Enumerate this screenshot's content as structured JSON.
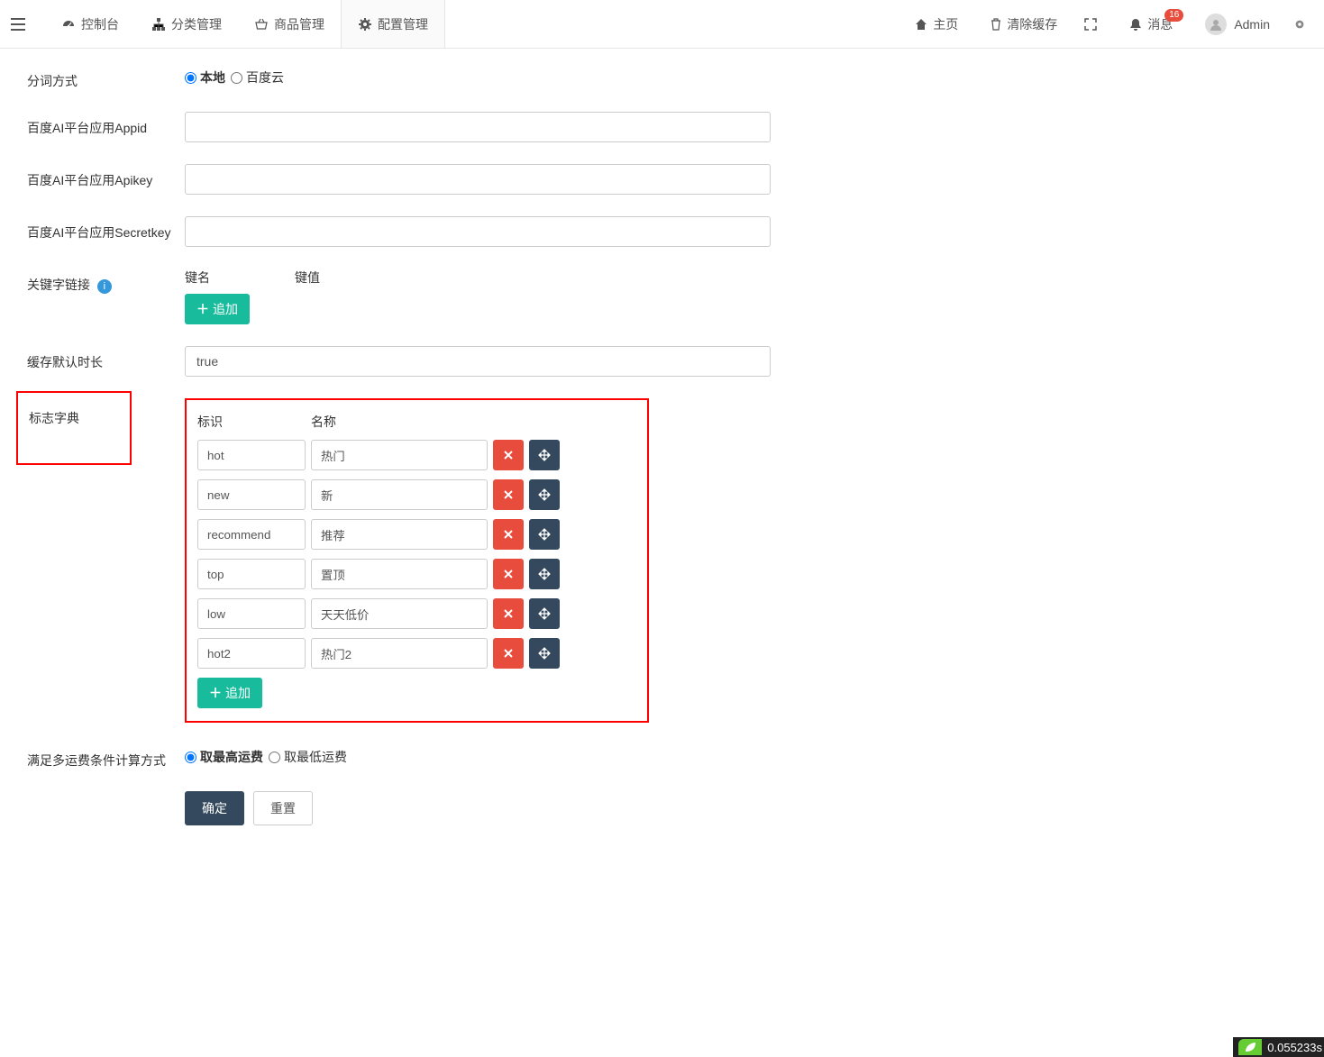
{
  "nav": {
    "left": [
      {
        "icon": "dashboard",
        "label": "控制台"
      },
      {
        "icon": "sitemap",
        "label": "分类管理"
      },
      {
        "icon": "basket",
        "label": "商品管理"
      },
      {
        "icon": "gear",
        "label": "配置管理"
      }
    ],
    "right": {
      "home": "主页",
      "clear_cache": "清除缓存",
      "messages": "消息",
      "badge": "16",
      "username": "Admin"
    }
  },
  "form": {
    "seg_label": "分词方式",
    "seg_opt1": "本地",
    "seg_opt2": "百度云",
    "appid_label": "百度AI平台应用Appid",
    "apikey_label": "百度AI平台应用Apikey",
    "secretkey_label": "百度AI平台应用Secretkey",
    "keyword_link_label": "关键字链接",
    "key_name": "键名",
    "key_value": "键值",
    "append_btn": "追加",
    "cache_ttl_label": "缓存默认时长",
    "cache_ttl_value": "true",
    "dict_label": "标志字典",
    "dict_key_header": "标识",
    "dict_val_header": "名称",
    "dict_rows": [
      {
        "key": "hot",
        "val": "热门"
      },
      {
        "key": "new",
        "val": "新"
      },
      {
        "key": "recommend",
        "val": "推荐"
      },
      {
        "key": "top",
        "val": "置顶"
      },
      {
        "key": "low",
        "val": "天天低价"
      },
      {
        "key": "hot2",
        "val": "热门2"
      }
    ],
    "shipping_label": "满足多运费条件计算方式",
    "shipping_opt1": "取最高运费",
    "shipping_opt2": "取最低运费",
    "submit": "确定",
    "reset": "重置"
  },
  "footer_time": "0.055233s"
}
